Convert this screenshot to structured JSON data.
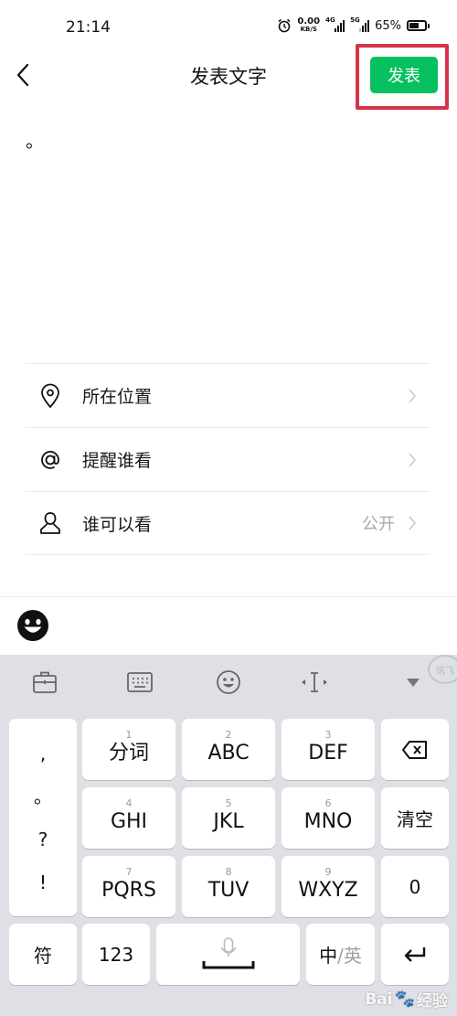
{
  "status_bar": {
    "time": "21:14",
    "net_speed_value": "0.00",
    "net_speed_unit": "KB/S",
    "sim1_tag": "4G",
    "sim2_tag": "5G",
    "battery_text": "65%",
    "battery_level": 0.65
  },
  "nav": {
    "title": "发表文字",
    "publish_label": "发表",
    "accent_color": "#07c160",
    "highlight_color": "#d6334a"
  },
  "compose": {
    "text": "。"
  },
  "options": [
    {
      "label": "所在位置",
      "value": "",
      "icon": "location-pin-icon"
    },
    {
      "label": "提醒谁看",
      "value": "",
      "icon": "at-sign-icon"
    },
    {
      "label": "谁可以看",
      "value": "公开",
      "icon": "person-icon"
    }
  ],
  "keyboard": {
    "logo": "讯飞",
    "side_left": [
      ",",
      "。",
      "?",
      "!"
    ],
    "rows": [
      [
        {
          "num": "1",
          "label": "分词"
        },
        {
          "num": "2",
          "label": "ABC"
        },
        {
          "num": "3",
          "label": "DEF"
        }
      ],
      [
        {
          "num": "4",
          "label": "GHI"
        },
        {
          "num": "5",
          "label": "JKL"
        },
        {
          "num": "6",
          "label": "MNO"
        }
      ],
      [
        {
          "num": "7",
          "label": "PQRS"
        },
        {
          "num": "8",
          "label": "TUV"
        },
        {
          "num": "9",
          "label": "WXYZ"
        }
      ]
    ],
    "clear_label": "清空",
    "zero_label": "0",
    "symbol_label": "符",
    "numeric_label": "123",
    "ime_cn": "中",
    "ime_sep": "/",
    "ime_en": "英"
  },
  "watermark": {
    "text": "Bai",
    "text2": "经验"
  }
}
